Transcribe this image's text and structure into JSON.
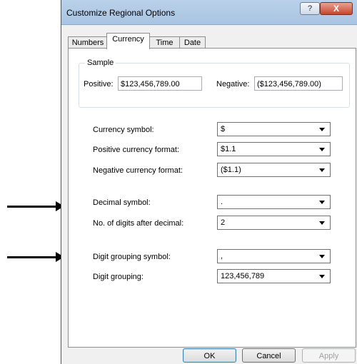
{
  "window": {
    "title": "Customize Regional Options",
    "help_glyph": "?",
    "close_glyph": "X"
  },
  "tabs": [
    {
      "label": "Numbers"
    },
    {
      "label": "Currency",
      "active": true
    },
    {
      "label": "Time"
    },
    {
      "label": "Date"
    }
  ],
  "sample": {
    "group_label": "Sample",
    "positive_label": "Positive:",
    "positive_value": "$123,456,789.00",
    "negative_label": "Negative:",
    "negative_value": "($123,456,789.00)"
  },
  "settings": [
    {
      "label": "Currency symbol:",
      "value": "$"
    },
    {
      "label": "Positive currency format:",
      "value": "$1.1"
    },
    {
      "label": "Negative currency format:",
      "value": "($1.1)"
    },
    {
      "label": "Decimal symbol:",
      "value": "."
    },
    {
      "label": "No. of digits after decimal:",
      "value": "2"
    },
    {
      "label": "Digit grouping symbol:",
      "value": ","
    },
    {
      "label": "Digit grouping:",
      "value": "123,456,789"
    }
  ],
  "buttons": {
    "ok": "OK",
    "cancel": "Cancel",
    "apply": "Apply"
  }
}
